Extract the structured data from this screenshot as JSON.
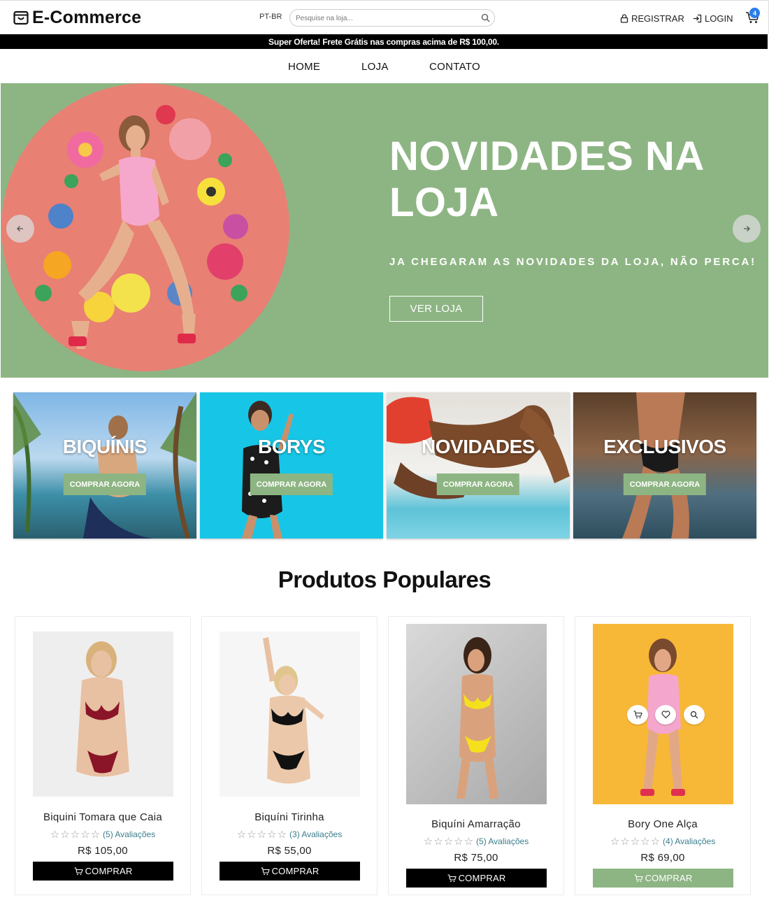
{
  "header": {
    "brand": "E-Commerce",
    "language": "PT-BR",
    "search_placeholder": "Pesquise na loja...",
    "register_label": "REGISTRAR",
    "login_label": "LOGIN",
    "cart_count": "4"
  },
  "announcement": "Super Oferta! Frete Grátis nas compras acima de R$ 100,00.",
  "nav": {
    "items": [
      {
        "label": "HOME"
      },
      {
        "label": "LOJA"
      },
      {
        "label": "CONTATO"
      }
    ]
  },
  "hero": {
    "title": "NOVIDADES NA LOJA",
    "subtitle": "JA CHEGARAM AS NOVIDADES DA LOJA, NÃO PERCA!",
    "button": "VER LOJA",
    "bg_color": "#8db583",
    "circle_color": "#e88074"
  },
  "categories": [
    {
      "name": "BIQUÍNIS",
      "button": "COMPRAR AGORA"
    },
    {
      "name": "BORYS",
      "button": "COMPRAR AGORA"
    },
    {
      "name": "NOVIDADES",
      "button": "COMPRAR AGORA"
    },
    {
      "name": "EXCLUSIVOS",
      "button": "COMPRAR AGORA"
    }
  ],
  "popular": {
    "title": "Produtos Populares",
    "products": [
      {
        "name": "Biquini Tomara que Caia",
        "rating": 0,
        "reviews": "(5) Avaliações",
        "price": "R$ 105,00",
        "button": "COMPRAR"
      },
      {
        "name": "Biquíni Tirinha",
        "rating": 0,
        "reviews": "(3) Avaliações",
        "price": "R$ 55,00",
        "button": "COMPRAR"
      },
      {
        "name": "Biquíni Amarração",
        "rating": 0,
        "reviews": "(5) Avaliações",
        "price": "R$ 75,00",
        "button": "COMPRAR"
      },
      {
        "name": "Bory One Alça",
        "rating": 0,
        "reviews": "(4) Avaliações",
        "price": "R$ 69,00",
        "button": "COMPRAR"
      }
    ]
  },
  "colors": {
    "accent_green": "#8db583",
    "badge_blue": "#2b7de9",
    "announcement_bg": "#000000"
  }
}
